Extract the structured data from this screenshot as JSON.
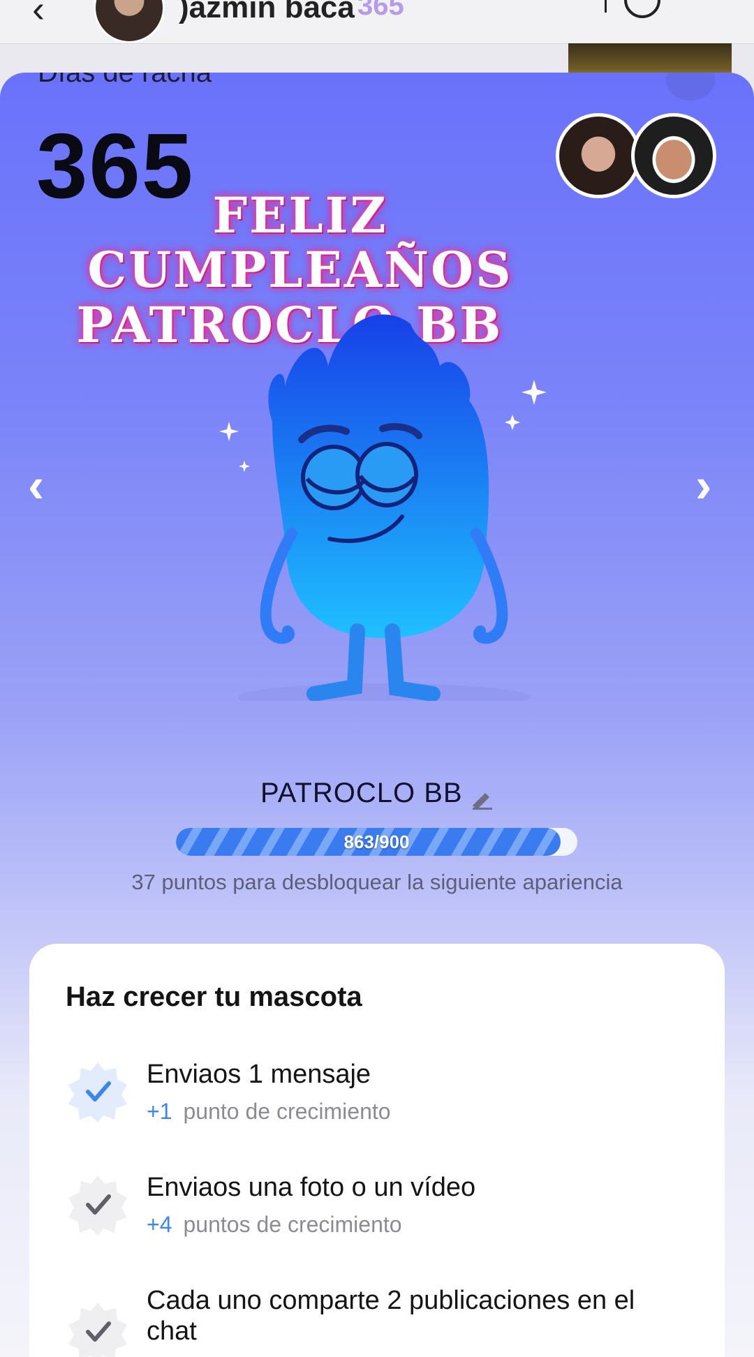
{
  "header": {
    "back_icon": "chevron-left-icon",
    "contact_name": ")azmin baca",
    "streak_badge": "365",
    "call_icon": "video-call-icon"
  },
  "sheet": {
    "streak_label": "Días de racha",
    "streak_count": "365",
    "birthday_line1": "FELIZ CUMPLEAÑOS",
    "birthday_line2": "PATROCLO BB"
  },
  "pet": {
    "name": "PATROCLO BB",
    "progress_current": 863,
    "progress_max": 900,
    "progress_text": "863/900",
    "unlock_hint": "37 puntos para desbloquear la siguiente apariencia",
    "colors": {
      "body_top": "#1740e8",
      "body_bottom": "#1fc0ff",
      "bg": "#6a72fb"
    }
  },
  "grow": {
    "title": "Haz crecer tu mascota",
    "tasks": [
      {
        "title": "Enviaos 1 mensaje",
        "points": "+1",
        "points_label": "punto de crecimiento",
        "done": true
      },
      {
        "title": "Enviaos una foto o un vídeo",
        "points": "+4",
        "points_label": "puntos de crecimiento",
        "done": false
      },
      {
        "title": "Cada uno comparte 2 publicaciones en el chat",
        "done": false
      }
    ]
  }
}
